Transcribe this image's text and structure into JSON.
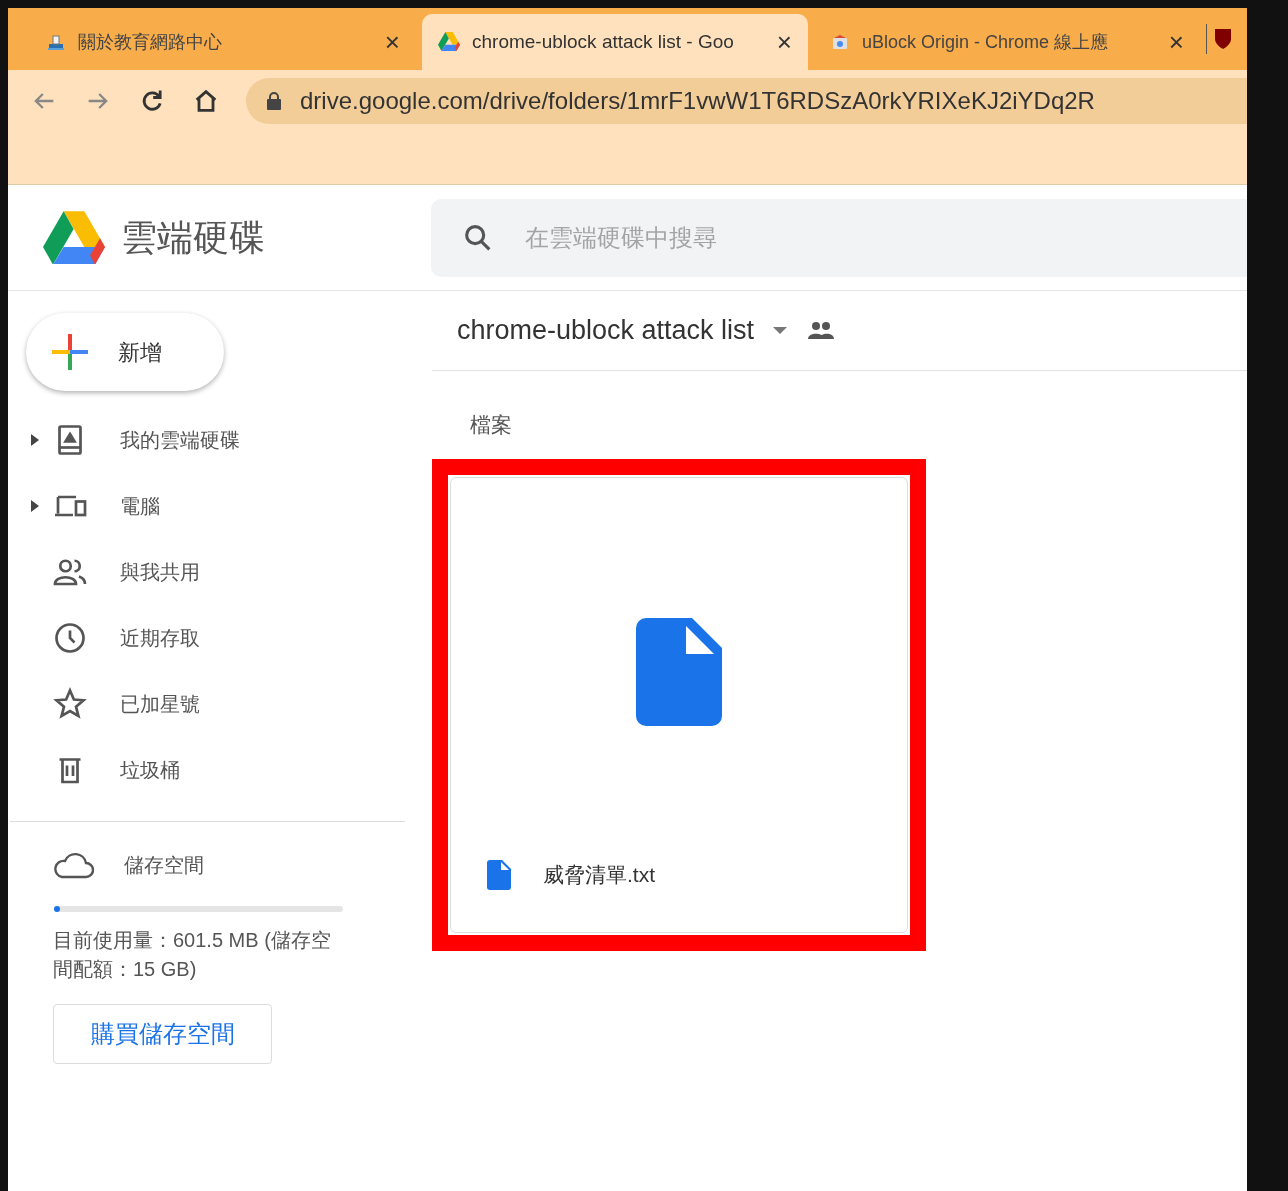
{
  "tabs": [
    {
      "title": "關於教育網路中心",
      "close": "×",
      "selected": false,
      "kind": "site"
    },
    {
      "title": "chrome-ublock attack list - Goo",
      "close": "×",
      "selected": true,
      "kind": "drive"
    },
    {
      "title": "uBlock Origin - Chrome 線上應",
      "close": "×",
      "selected": false,
      "kind": "store"
    }
  ],
  "address_bar": {
    "url": "drive.google.com/drive/folders/1mrF1vwW1T6RDSzA0rkYRIXeKJ2iYDq2R"
  },
  "app": {
    "title": "雲端硬碟"
  },
  "search": {
    "placeholder": "在雲端硬碟中搜尋"
  },
  "new_button": "新增",
  "sidebar": {
    "items": [
      {
        "label": "我的雲端硬碟",
        "kind": "drive",
        "expandable": true
      },
      {
        "label": "電腦",
        "kind": "computer",
        "expandable": true
      },
      {
        "label": "與我共用",
        "kind": "shared",
        "expandable": false
      },
      {
        "label": "近期存取",
        "kind": "recent",
        "expandable": false
      },
      {
        "label": "已加星號",
        "kind": "star",
        "expandable": false
      },
      {
        "label": "垃圾桶",
        "kind": "trash",
        "expandable": false
      }
    ]
  },
  "storage": {
    "label": "儲存空間",
    "level": 0.02,
    "usage": "目前使用量：601.5 MB (儲存空間配額：15 GB)",
    "buy": "購買儲存空間"
  },
  "folder": {
    "title": "chrome-ublock attack list",
    "section": "檔案",
    "files": [
      {
        "name": "威脅清單.txt"
      }
    ]
  }
}
